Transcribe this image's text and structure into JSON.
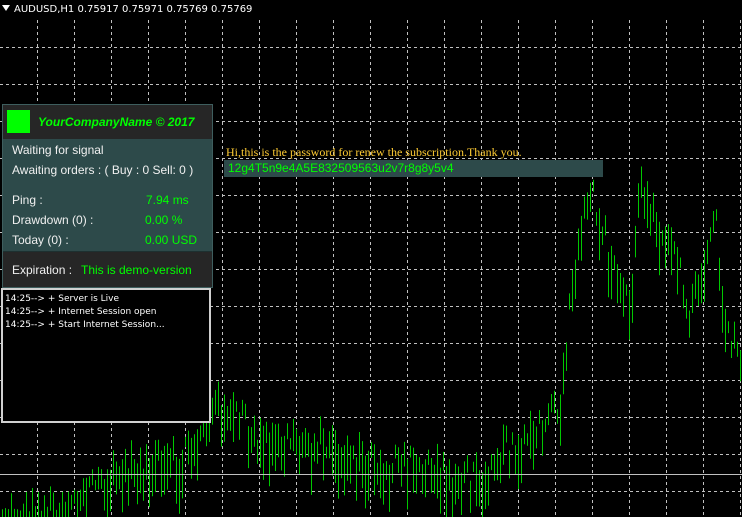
{
  "chart": {
    "symbol_line": "AUDUSD,H1  0.75917 0.75971 0.75769 0.75769",
    "background_color": "#000000",
    "grid_color": "#c0c0c0",
    "price_line_color": "#c0c0c0",
    "candle_color": "#00c800"
  },
  "panel": {
    "company": "YourCompanyName © 2017",
    "status": "Waiting for signal",
    "orders": "Awaiting orders : ( Buy : 0 Sell: 0 )",
    "ping_label": "Ping :",
    "ping_value": "7.94 ms",
    "drawdown_label": "Drawdown (0) :",
    "drawdown_value": "0.00  %",
    "today_label": "Today (0) :",
    "today_value": "0.00  USD",
    "expiration_label": "Expiration :",
    "expiration_value": "This is demo-version",
    "logo_color": "#00ff00",
    "accent_color": "#00ff00",
    "panel_color": "#2d4a4a"
  },
  "log": {
    "lines": [
      "14:25--> + Server is Live",
      "14:25--> + Internet Session open",
      "14:25--> + Start Internet Session..."
    ]
  },
  "password": {
    "message": "Hi,this is the password for renew the subscription.Thank you.",
    "value": "12g4T5n9e4A5E832509563u2v7r8g8y5v4",
    "message_color": "#ffcc33"
  }
}
